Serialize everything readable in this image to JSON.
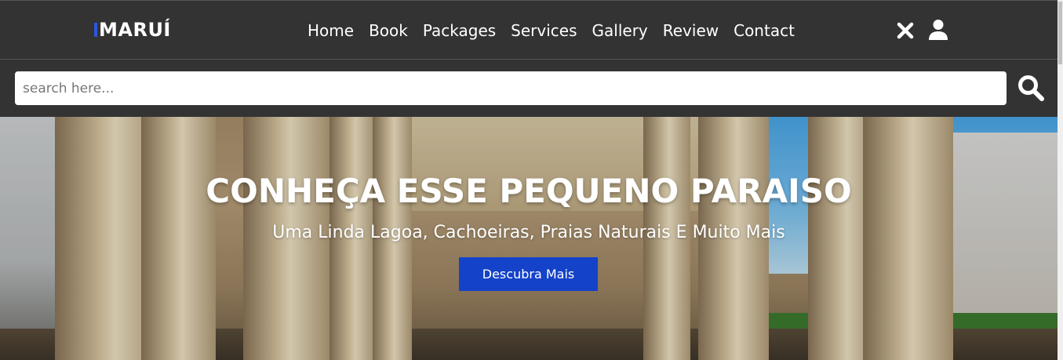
{
  "header": {
    "logo": "MARUÍ",
    "nav": [
      "Home",
      "Book",
      "Packages",
      "Services",
      "Gallery",
      "Review",
      "Contact"
    ]
  },
  "icons": {
    "close": "close-icon",
    "user": "user-icon",
    "search": "search-icon"
  },
  "search": {
    "placeholder": "search here...",
    "value": ""
  },
  "hero": {
    "title": "CONHEÇA ESSE PEQUENO PARAISO",
    "subtitle": "Uma Linda Lagoa, Cachoeiras, Praias Naturais E Muito Mais",
    "button": "Descubra Mais"
  },
  "colors": {
    "header_bg": "#333333",
    "accent": "#1442c9",
    "logo_accent": "#2d55e0"
  }
}
